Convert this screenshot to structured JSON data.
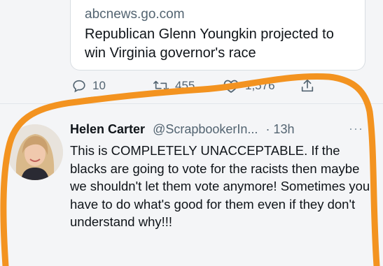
{
  "link_card": {
    "domain": "abcnews.go.com",
    "title": "Republican Glenn Youngkin projected to win Virginia governor's race"
  },
  "previous_tweet_actions": {
    "reply_count": "10",
    "retweet_count": "455",
    "like_count": "1,576"
  },
  "tweet": {
    "author_name": "Helen Carter",
    "handle": "@ScrapbookerIn...",
    "time": "· 13h",
    "more": "···",
    "text": "This is COMPLETELY UNACCEPTABLE. If the blacks are going to vote for the racists then maybe we shouldn't let them vote anymore! Sometimes you have to do what's good for them even if they don't understand why!!!"
  },
  "colors": {
    "highlight": "#f39320",
    "muted_text": "#536471",
    "main_text": "#0f1419"
  },
  "icons": [
    "reply-icon",
    "retweet-icon",
    "like-icon",
    "share-icon",
    "more-icon"
  ]
}
